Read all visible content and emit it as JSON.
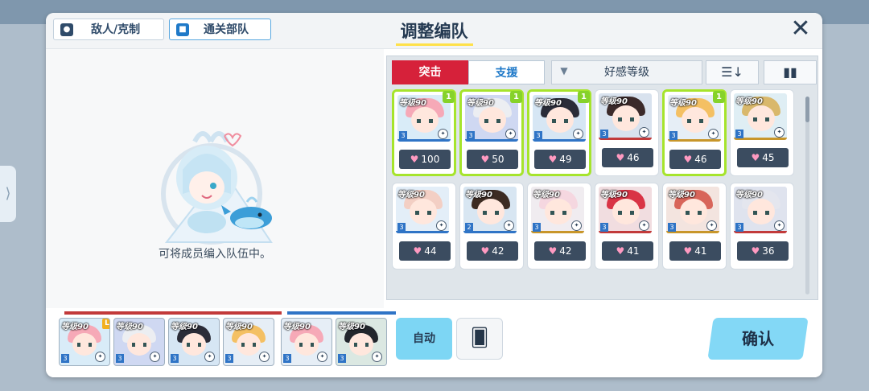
{
  "header": {
    "title": "调整编队",
    "enemy_btn": "敌人/克制",
    "clear_team_btn": "通关部队",
    "close_icon": "close-icon"
  },
  "left_panel": {
    "hint": "可将成员编入队伍中。"
  },
  "filter": {
    "strikers_tab": "突击",
    "special_tab": "支援",
    "sort_label": "好感等级",
    "sort_order_icon": "sort-descending-icon",
    "view_icon": "grid-view-icon"
  },
  "students": [
    {
      "level": "等级90",
      "rank": "3",
      "bond": "100",
      "badge": "1",
      "selected": true,
      "hair": "#f6a9b7",
      "bg": "#d9ecf8",
      "stripe": "#2f74c6"
    },
    {
      "level": "等级90",
      "rank": "3",
      "bond": "50",
      "badge": "1",
      "selected": true,
      "hair": "#eceef2",
      "bg": "#cfd8f2",
      "stripe": "#2f74c6"
    },
    {
      "level": "等级90",
      "rank": "3",
      "bond": "49",
      "badge": "1",
      "selected": true,
      "hair": "#2a2c38",
      "bg": "#d6e6f4",
      "stripe": "#2f74c6"
    },
    {
      "level": "等级90",
      "rank": "3",
      "bond": "46",
      "badge": "",
      "selected": false,
      "hair": "#3b2a2a",
      "bg": "#d8e2ee",
      "stripe": "#c23a3a"
    },
    {
      "level": "等级90",
      "rank": "3",
      "bond": "46",
      "badge": "1",
      "selected": true,
      "hair": "#f4c063",
      "bg": "#e6eef6",
      "stripe": "#c8962a"
    },
    {
      "level": "等级90",
      "rank": "3",
      "bond": "45",
      "badge": "",
      "selected": false,
      "hair": "#d9b86b",
      "bg": "#dfeef4",
      "stripe": "#c8962a"
    },
    {
      "level": "等级90",
      "rank": "3",
      "bond": "44",
      "badge": "",
      "selected": false,
      "hair": "#f3cfc4",
      "bg": "#e3eef8",
      "stripe": "#2f74c6"
    },
    {
      "level": "等级90",
      "rank": "2",
      "bond": "42",
      "badge": "",
      "selected": false,
      "hair": "#3c2b22",
      "bg": "#d8e6f2",
      "stripe": "#2f74c6"
    },
    {
      "level": "等级90",
      "rank": "3",
      "bond": "42",
      "badge": "",
      "selected": false,
      "hair": "#f5d7e0",
      "bg": "#f0ecf0",
      "stripe": "#c8962a"
    },
    {
      "level": "等级90",
      "rank": "3",
      "bond": "41",
      "badge": "",
      "selected": false,
      "hair": "#d93445",
      "bg": "#f1dde0",
      "stripe": "#c23a3a"
    },
    {
      "level": "等级90",
      "rank": "3",
      "bond": "41",
      "badge": "",
      "selected": false,
      "hair": "#d8655a",
      "bg": "#f3e4df",
      "stripe": "#c8962a"
    },
    {
      "level": "等级90",
      "rank": "3",
      "bond": "36",
      "badge": "",
      "selected": false,
      "hair": "#e4e6ee",
      "bg": "#dfe3ee",
      "stripe": "#c23a3a"
    }
  ],
  "team": {
    "strikers": [
      {
        "level": "等级90",
        "rank": "3",
        "leader": "L",
        "hair": "#f6a9b7",
        "bg": "#d9ecf8"
      },
      {
        "level": "等级90",
        "rank": "3",
        "leader": "",
        "hair": "#eceef2",
        "bg": "#cfd8f2"
      },
      {
        "level": "等级90",
        "rank": "3",
        "leader": "",
        "hair": "#2a2c38",
        "bg": "#d6e6f4"
      },
      {
        "level": "等级90",
        "rank": "3",
        "leader": "",
        "hair": "#f4c063",
        "bg": "#e6eef6"
      }
    ],
    "specials": [
      {
        "level": "等级90",
        "rank": "3",
        "leader": "",
        "hair": "#f6a9b7",
        "bg": "#e6eef6"
      },
      {
        "level": "等级90",
        "rank": "3",
        "leader": "",
        "hair": "#22262c",
        "bg": "#dbe8e2"
      }
    ],
    "striker_color": "#c23a3a",
    "special_color": "#2f74c6"
  },
  "actions": {
    "auto": "自动",
    "cards_icon": "cards-icon",
    "confirm": "确认"
  }
}
